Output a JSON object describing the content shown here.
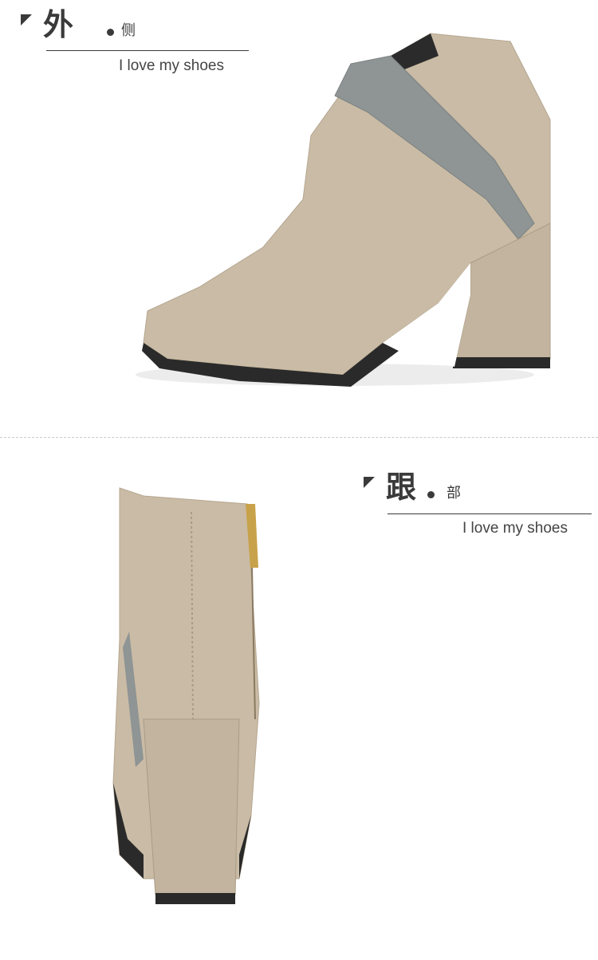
{
  "sections": {
    "side": {
      "title_big": "外",
      "title_small": "侧",
      "tagline": "I love my shoes",
      "photo_icon": "ankle-boot-side-view-icon"
    },
    "heel": {
      "title_big": "跟",
      "title_small": "部",
      "tagline": "I love my shoes",
      "photo_icon": "ankle-boot-heel-view-icon"
    }
  },
  "colors": {
    "suede": "#c9bba5",
    "suede_shadow": "#a99b85",
    "stripe_gray": "#8f9494",
    "sole": "#2a2a2a",
    "zipper": "#c8a24a",
    "text": "#3a3a3a"
  }
}
